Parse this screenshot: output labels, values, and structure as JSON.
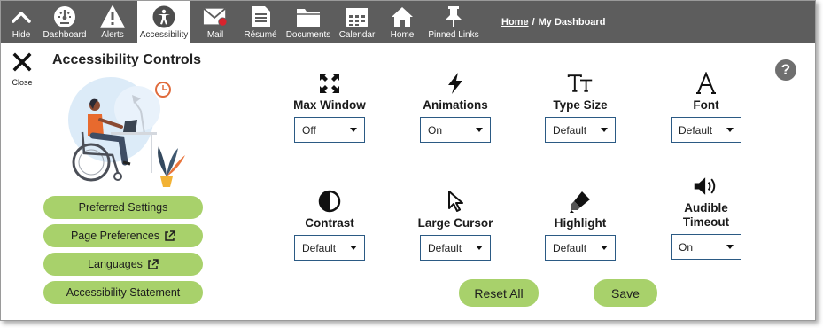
{
  "nav": {
    "items": [
      {
        "label": "Hide",
        "icon": "chevron-up-icon"
      },
      {
        "label": "Dashboard",
        "icon": "speedometer-icon"
      },
      {
        "label": "Alerts",
        "icon": "warning-icon"
      },
      {
        "label": "Accessibility",
        "icon": "accessibility-icon"
      },
      {
        "label": "Mail",
        "icon": "mail-icon"
      },
      {
        "label": "Résumé",
        "icon": "document-icon"
      },
      {
        "label": "Documents",
        "icon": "folder-icon"
      },
      {
        "label": "Calendar",
        "icon": "calendar-icon"
      },
      {
        "label": "Home",
        "icon": "home-icon"
      },
      {
        "label": "Pinned Links",
        "icon": "pin-icon"
      }
    ],
    "active": "Accessibility"
  },
  "breadcrumb": {
    "home": "Home",
    "separator": "/",
    "current": "My Dashboard"
  },
  "sidebar": {
    "close_label": "Close",
    "title": "Accessibility Controls",
    "buttons": [
      {
        "label": "Preferred Settings"
      },
      {
        "label": "Page Preferences"
      },
      {
        "label": "Languages"
      },
      {
        "label": "Accessibility Statement"
      }
    ]
  },
  "help": {
    "label": "?"
  },
  "controls": [
    {
      "label": "Max Window",
      "value": "Off",
      "icon": "expand-arrows-icon"
    },
    {
      "label": "Animations",
      "value": "On",
      "icon": "lightning-icon"
    },
    {
      "label": "Type Size",
      "value": "Default",
      "icon": "text-size-icon"
    },
    {
      "label": "Font",
      "value": "Default",
      "icon": "font-icon"
    },
    {
      "label": "Contrast",
      "value": "Default",
      "icon": "contrast-icon"
    },
    {
      "label": "Large Cursor",
      "value": "Default",
      "icon": "cursor-icon"
    },
    {
      "label": "Highlight",
      "value": "Default",
      "icon": "highlighter-icon"
    },
    {
      "label": "Audible Timeout",
      "label_line1": "Audible",
      "label_line2": "Timeout",
      "value": "On",
      "icon": "speaker-icon"
    }
  ],
  "actions": {
    "reset": "Reset All",
    "save": "Save"
  },
  "colors": {
    "topbar": "#5d5d5d",
    "button_green": "#a8d16b",
    "select_border": "#2b5a84"
  }
}
